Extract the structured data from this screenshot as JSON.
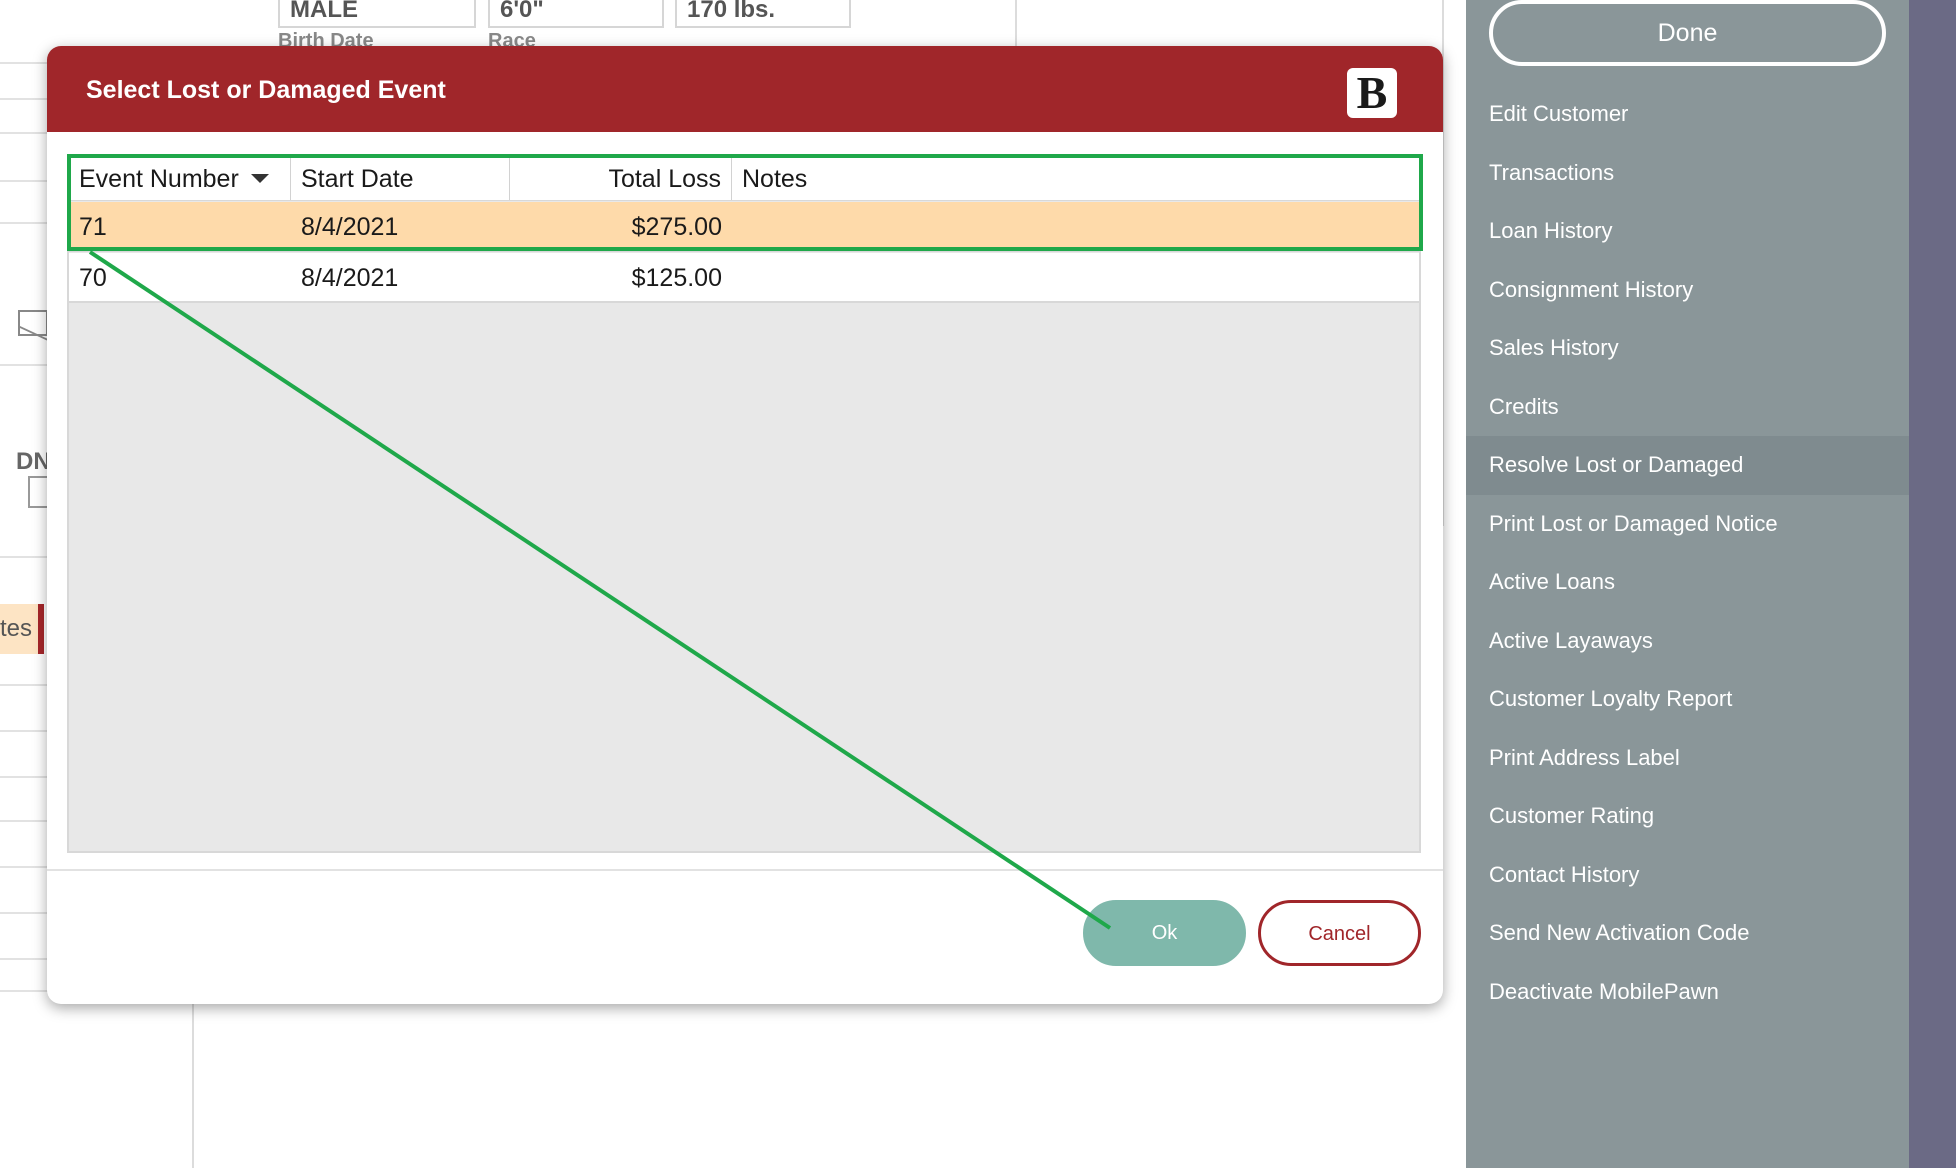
{
  "background": {
    "fields": [
      "MALE",
      "6'0\"",
      "170 lbs."
    ],
    "labels": [
      "Birth Date",
      "Race"
    ],
    "fragments": {
      "dn": "DN",
      "tab": "tes"
    }
  },
  "dialog": {
    "title": "Select Lost or Damaged Event",
    "logo_letter": "B",
    "columns": [
      "Event Number",
      "Start Date",
      "Total Loss",
      "Notes"
    ],
    "sorted_column": "Event Number",
    "sort_direction": "descending",
    "rows": [
      {
        "event_number": "71",
        "start_date": "8/4/2021",
        "total_loss": "$275.00",
        "notes": "",
        "selected": true
      },
      {
        "event_number": "70",
        "start_date": "8/4/2021",
        "total_loss": "$125.00",
        "notes": "",
        "selected": false
      }
    ],
    "ok_label": "Ok",
    "cancel_label": "Cancel"
  },
  "sidebar": {
    "done_label": "Done",
    "items": [
      "Edit Customer",
      "Transactions",
      "Loan History",
      "Consignment History",
      "Sales History",
      "Credits",
      "Resolve Lost or Damaged",
      "Print Lost or Damaged Notice",
      "Active Loans",
      "Active Layaways",
      "Customer Loyalty Report",
      "Print Address Label",
      "Customer Rating",
      "Contact History",
      "Send New Activation Code",
      "Deactivate MobilePawn"
    ],
    "active_item": "Resolve Lost or Damaged"
  },
  "colors": {
    "header_red": "#a0262a",
    "selected_row": "#fedaaa",
    "ok_button": "#7fb8ab",
    "sidebar": "#8a9699",
    "annotation_green": "#1fa84a"
  }
}
